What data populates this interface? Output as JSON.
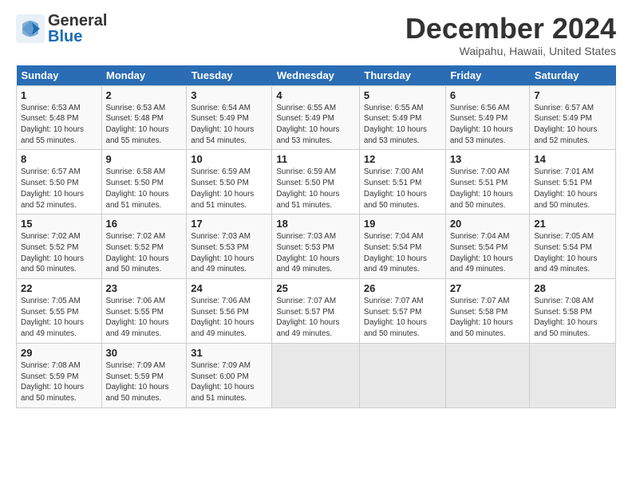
{
  "header": {
    "logo_general": "General",
    "logo_blue": "Blue",
    "month": "December 2024",
    "location": "Waipahu, Hawaii, United States"
  },
  "columns": [
    "Sunday",
    "Monday",
    "Tuesday",
    "Wednesday",
    "Thursday",
    "Friday",
    "Saturday"
  ],
  "weeks": [
    [
      {
        "day": "1",
        "info": "Sunrise: 6:53 AM\nSunset: 5:48 PM\nDaylight: 10 hours\nand 55 minutes."
      },
      {
        "day": "2",
        "info": "Sunrise: 6:53 AM\nSunset: 5:48 PM\nDaylight: 10 hours\nand 55 minutes."
      },
      {
        "day": "3",
        "info": "Sunrise: 6:54 AM\nSunset: 5:49 PM\nDaylight: 10 hours\nand 54 minutes."
      },
      {
        "day": "4",
        "info": "Sunrise: 6:55 AM\nSunset: 5:49 PM\nDaylight: 10 hours\nand 53 minutes."
      },
      {
        "day": "5",
        "info": "Sunrise: 6:55 AM\nSunset: 5:49 PM\nDaylight: 10 hours\nand 53 minutes."
      },
      {
        "day": "6",
        "info": "Sunrise: 6:56 AM\nSunset: 5:49 PM\nDaylight: 10 hours\nand 53 minutes."
      },
      {
        "day": "7",
        "info": "Sunrise: 6:57 AM\nSunset: 5:49 PM\nDaylight: 10 hours\nand 52 minutes."
      }
    ],
    [
      {
        "day": "8",
        "info": "Sunrise: 6:57 AM\nSunset: 5:50 PM\nDaylight: 10 hours\nand 52 minutes."
      },
      {
        "day": "9",
        "info": "Sunrise: 6:58 AM\nSunset: 5:50 PM\nDaylight: 10 hours\nand 51 minutes."
      },
      {
        "day": "10",
        "info": "Sunrise: 6:59 AM\nSunset: 5:50 PM\nDaylight: 10 hours\nand 51 minutes."
      },
      {
        "day": "11",
        "info": "Sunrise: 6:59 AM\nSunset: 5:50 PM\nDaylight: 10 hours\nand 51 minutes."
      },
      {
        "day": "12",
        "info": "Sunrise: 7:00 AM\nSunset: 5:51 PM\nDaylight: 10 hours\nand 50 minutes."
      },
      {
        "day": "13",
        "info": "Sunrise: 7:00 AM\nSunset: 5:51 PM\nDaylight: 10 hours\nand 50 minutes."
      },
      {
        "day": "14",
        "info": "Sunrise: 7:01 AM\nSunset: 5:51 PM\nDaylight: 10 hours\nand 50 minutes."
      }
    ],
    [
      {
        "day": "15",
        "info": "Sunrise: 7:02 AM\nSunset: 5:52 PM\nDaylight: 10 hours\nand 50 minutes."
      },
      {
        "day": "16",
        "info": "Sunrise: 7:02 AM\nSunset: 5:52 PM\nDaylight: 10 hours\nand 50 minutes."
      },
      {
        "day": "17",
        "info": "Sunrise: 7:03 AM\nSunset: 5:53 PM\nDaylight: 10 hours\nand 49 minutes."
      },
      {
        "day": "18",
        "info": "Sunrise: 7:03 AM\nSunset: 5:53 PM\nDaylight: 10 hours\nand 49 minutes."
      },
      {
        "day": "19",
        "info": "Sunrise: 7:04 AM\nSunset: 5:54 PM\nDaylight: 10 hours\nand 49 minutes."
      },
      {
        "day": "20",
        "info": "Sunrise: 7:04 AM\nSunset: 5:54 PM\nDaylight: 10 hours\nand 49 minutes."
      },
      {
        "day": "21",
        "info": "Sunrise: 7:05 AM\nSunset: 5:54 PM\nDaylight: 10 hours\nand 49 minutes."
      }
    ],
    [
      {
        "day": "22",
        "info": "Sunrise: 7:05 AM\nSunset: 5:55 PM\nDaylight: 10 hours\nand 49 minutes."
      },
      {
        "day": "23",
        "info": "Sunrise: 7:06 AM\nSunset: 5:55 PM\nDaylight: 10 hours\nand 49 minutes."
      },
      {
        "day": "24",
        "info": "Sunrise: 7:06 AM\nSunset: 5:56 PM\nDaylight: 10 hours\nand 49 minutes."
      },
      {
        "day": "25",
        "info": "Sunrise: 7:07 AM\nSunset: 5:57 PM\nDaylight: 10 hours\nand 49 minutes."
      },
      {
        "day": "26",
        "info": "Sunrise: 7:07 AM\nSunset: 5:57 PM\nDaylight: 10 hours\nand 50 minutes."
      },
      {
        "day": "27",
        "info": "Sunrise: 7:07 AM\nSunset: 5:58 PM\nDaylight: 10 hours\nand 50 minutes."
      },
      {
        "day": "28",
        "info": "Sunrise: 7:08 AM\nSunset: 5:58 PM\nDaylight: 10 hours\nand 50 minutes."
      }
    ],
    [
      {
        "day": "29",
        "info": "Sunrise: 7:08 AM\nSunset: 5:59 PM\nDaylight: 10 hours\nand 50 minutes."
      },
      {
        "day": "30",
        "info": "Sunrise: 7:09 AM\nSunset: 5:59 PM\nDaylight: 10 hours\nand 50 minutes."
      },
      {
        "day": "31",
        "info": "Sunrise: 7:09 AM\nSunset: 6:00 PM\nDaylight: 10 hours\nand 51 minutes."
      },
      {
        "day": "",
        "info": ""
      },
      {
        "day": "",
        "info": ""
      },
      {
        "day": "",
        "info": ""
      },
      {
        "day": "",
        "info": ""
      }
    ]
  ]
}
